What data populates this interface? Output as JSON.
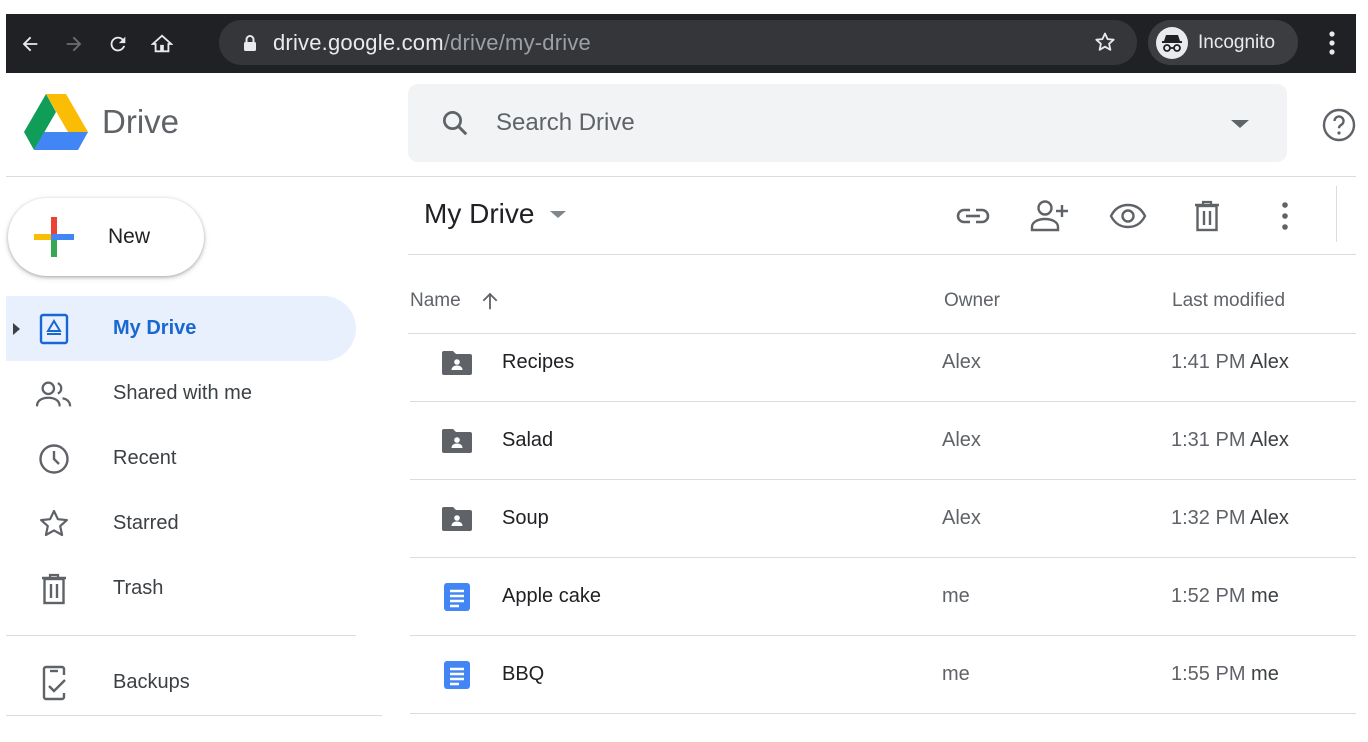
{
  "browser": {
    "url_host": "drive.google.com",
    "url_path": "/drive/my-drive",
    "incognito_label": "Incognito",
    "icons": [
      "back-icon",
      "forward-icon",
      "reload-icon",
      "home-icon",
      "lock-icon",
      "star-icon",
      "incognito-icon",
      "menu-icon"
    ]
  },
  "header": {
    "logo_text": "Drive",
    "search_placeholder": "Search Drive"
  },
  "sidebar": {
    "new_label": "New",
    "items": [
      {
        "label": "My Drive",
        "icon": "my-drive-icon",
        "active": true
      },
      {
        "label": "Shared with me",
        "icon": "shared-icon"
      },
      {
        "label": "Recent",
        "icon": "clock-icon"
      },
      {
        "label": "Starred",
        "icon": "star-icon"
      },
      {
        "label": "Trash",
        "icon": "trash-icon"
      },
      {
        "label": "Backups",
        "icon": "backup-icon"
      }
    ]
  },
  "toolbar": {
    "title": "My Drive",
    "actions": [
      "link-icon",
      "add-person-icon",
      "preview-icon",
      "trash-icon",
      "more-icon"
    ]
  },
  "table": {
    "columns": [
      "Name",
      "Owner",
      "Last modified"
    ],
    "rows": [
      {
        "name": "Recipes",
        "type": "shared-folder",
        "owner": "Alex",
        "time": "1:41 PM",
        "by": "Alex"
      },
      {
        "name": "Salad",
        "type": "shared-folder",
        "owner": "Alex",
        "time": "1:31 PM",
        "by": "Alex"
      },
      {
        "name": "Soup",
        "type": "shared-folder",
        "owner": "Alex",
        "time": "1:32 PM",
        "by": "Alex"
      },
      {
        "name": "Apple cake",
        "type": "doc",
        "owner": "me",
        "time": "1:52 PM",
        "by": "me"
      },
      {
        "name": "BBQ",
        "type": "doc",
        "owner": "me",
        "time": "1:55 PM",
        "by": "me"
      }
    ]
  },
  "colors": {
    "active_blue": "#1967d2",
    "active_bg": "#e8f0fe",
    "doc_blue": "#4285f4",
    "folder_grey": "#5f6368"
  }
}
